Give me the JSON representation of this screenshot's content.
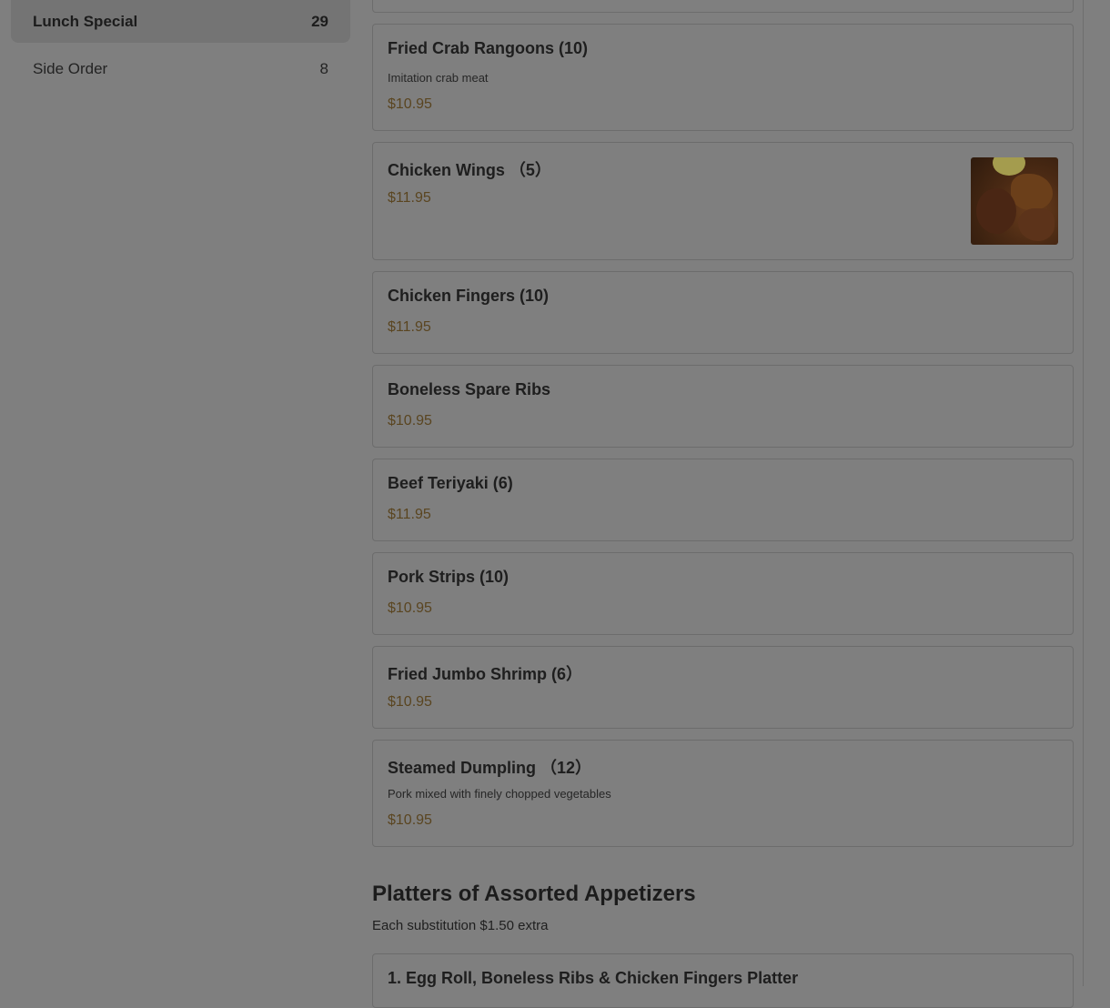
{
  "sidebar": {
    "items": [
      {
        "label": "Lunch Special",
        "count": "29"
      },
      {
        "label": "Side Order",
        "count": "8"
      }
    ]
  },
  "menu": {
    "items": [
      {
        "name": "Fried Crab Rangoons (10)",
        "description": "Imitation crab meat",
        "price": "$10.95"
      },
      {
        "name": "Chicken Wings （5）",
        "price": "$11.95",
        "image_icon": "chicken-wings-photo"
      },
      {
        "name": "Chicken Fingers (10)",
        "price": "$11.95"
      },
      {
        "name": "Boneless Spare Ribs",
        "price": "$10.95"
      },
      {
        "name": "Beef Teriyaki (6)",
        "price": "$11.95"
      },
      {
        "name": "Pork Strips (10)",
        "price": "$10.95"
      },
      {
        "name": "Fried Jumbo Shrimp (6）",
        "price": "$10.95"
      },
      {
        "name": "Steamed Dumpling （12）",
        "description": "Pork mixed with finely chopped vegetables",
        "price": "$10.95"
      }
    ],
    "section": {
      "title": "Platters of Assorted Appetizers",
      "subtitle": "Each substitution $1.50 extra",
      "items": [
        {
          "name": "1. Egg Roll, Boneless Ribs & Chicken Fingers Platter"
        }
      ]
    }
  },
  "colors": {
    "overlay_background": "#7f7f7f",
    "price": "#5a4520",
    "active_sidebar": "#747474"
  }
}
